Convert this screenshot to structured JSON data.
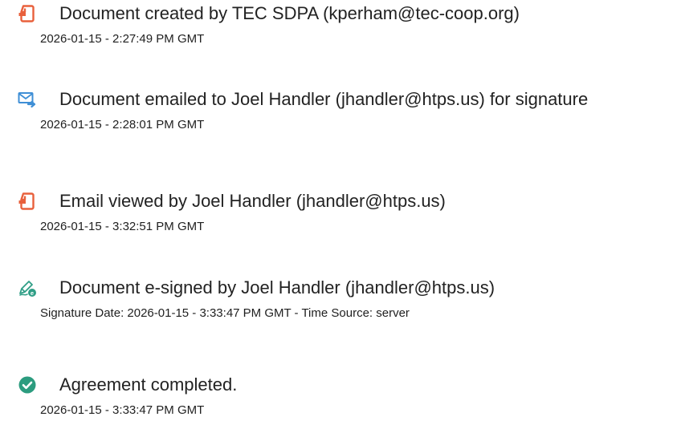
{
  "events": [
    {
      "icon": "pdf-document-icon",
      "title": "Document created by TEC SDPA (kperham@tec-coop.org)",
      "meta": "2026-01-15 - 2:27:49 PM GMT"
    },
    {
      "icon": "email-sent-icon",
      "title": "Document emailed to Joel Handler (jhandler@htps.us) for signature",
      "meta": "2026-01-15 - 2:28:01 PM GMT"
    },
    {
      "icon": "pdf-document-icon",
      "title": "Email viewed by Joel Handler (jhandler@htps.us)",
      "meta": "2026-01-15 - 3:32:51 PM GMT"
    },
    {
      "icon": "e-sign-pen-icon",
      "title": "Document e-signed by Joel Handler (jhandler@htps.us)",
      "meta": "Signature Date: 2026-01-15 - 3:33:47 PM GMT - Time Source: server"
    },
    {
      "icon": "check-circle-icon",
      "title": "Agreement completed.",
      "meta": "2026-01-15 - 3:33:47 PM GMT"
    }
  ],
  "colors": {
    "pdf_icon": "#e8603c",
    "email_icon": "#3f8fd6",
    "sign_icon": "#2f9e86",
    "check_icon": "#2c9c7f"
  }
}
